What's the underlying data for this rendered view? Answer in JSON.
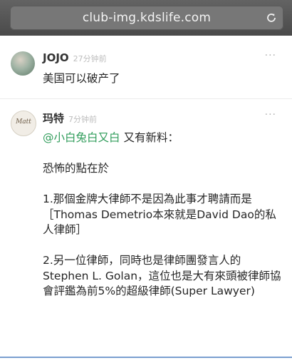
{
  "browser": {
    "url": "club-img.kdslife.com"
  },
  "comments": [
    {
      "author": "JOJO",
      "time": "27分钟前",
      "text": "美国可以破产了",
      "more": "···"
    },
    {
      "author": "玛特",
      "time": "7分钟前",
      "avatar_text": "Matt",
      "more": "···",
      "mention": "@小白兔白又白",
      "mention_suffix": " 又有新料：",
      "text": "\n\n恐怖的點在於\n\n1.那個金牌大律師不是因為此事才聘請而是［Thomas Demetrio本來就是David Dao的私人律師］\n\n2.另一位律師，同時也是律師團發言人的Stephen L. Golan，這位也是大有來頭被律師協會評鑑為前5%的超級律師(Super Lawyer)"
    }
  ]
}
